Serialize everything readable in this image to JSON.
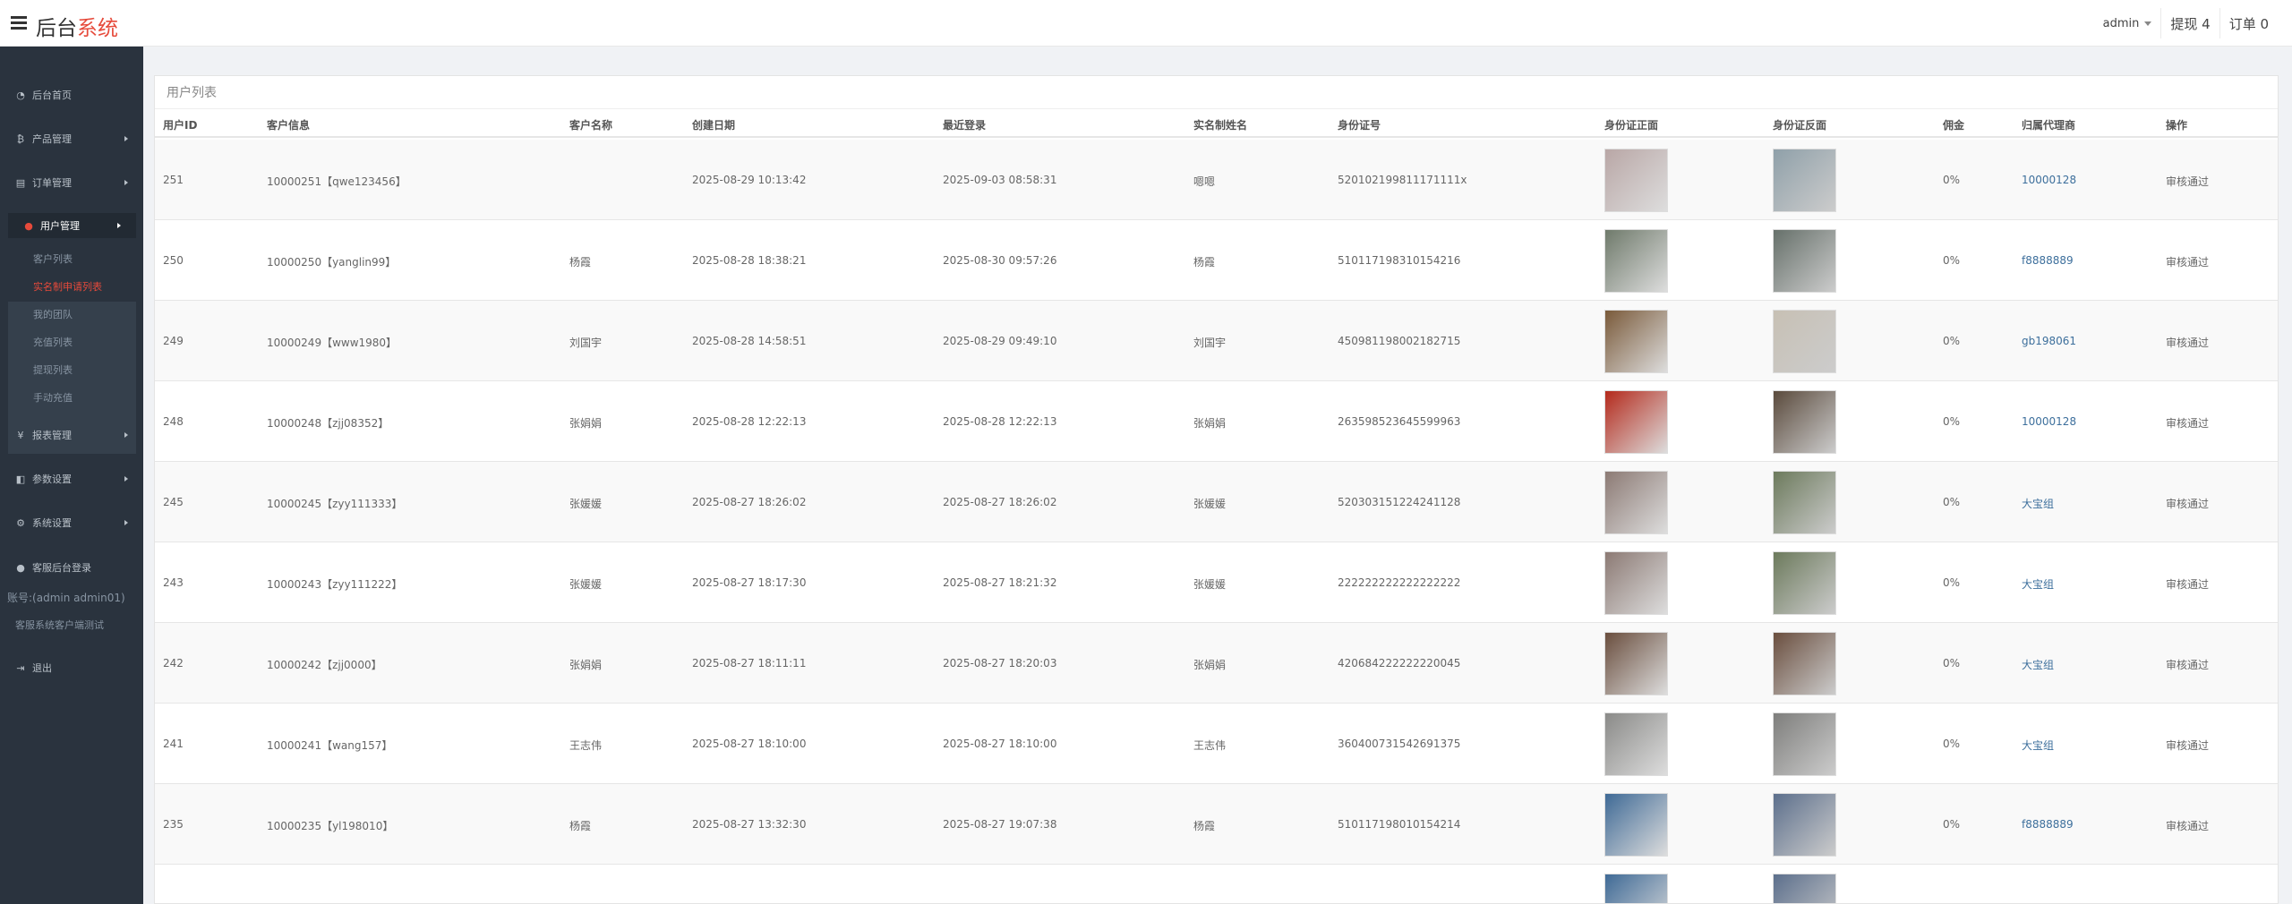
{
  "header": {
    "brand_main": "后台",
    "brand_accent": "系统",
    "admin_label": "admin",
    "withdraw_label": "提现 4",
    "orders_label": "订单 0"
  },
  "sidebar": {
    "items": [
      {
        "label": "后台首页",
        "icon": "dashboard-icon"
      },
      {
        "label": "产品管理",
        "icon": "bitcoin-icon"
      },
      {
        "label": "订单管理",
        "icon": "order-icon"
      },
      {
        "label": "用户管理",
        "icon": "user-icon"
      },
      {
        "label": "报表管理",
        "icon": "yen-icon"
      },
      {
        "label": "参数设置",
        "icon": "params-icon"
      },
      {
        "label": "系统设置",
        "icon": "settings-icon"
      },
      {
        "label": "客服后台登录",
        "icon": "support-user-icon"
      },
      {
        "label": "退出",
        "icon": "logout-icon"
      }
    ],
    "subitems": [
      "客户列表",
      "实名制申请列表",
      "我的团队",
      "充值列表",
      "提现列表",
      "手动充值"
    ],
    "account_text": "账号:(admin admin01)",
    "test_text": "客服系统客户端测试"
  },
  "panel": {
    "title": "用户列表",
    "columns": [
      "用户ID",
      "客户信息",
      "客户名称",
      "创建日期",
      "最近登录",
      "实名制姓名",
      "身份证号",
      "身份证正面",
      "身份证反面",
      "佣金",
      "归属代理商",
      "操作"
    ]
  },
  "rows": [
    {
      "id": "251",
      "info": "10000251【qwe123456】",
      "name": "",
      "created": "2025-08-29 10:13:42",
      "last": "2025-09-03 08:58:31",
      "real": "嗯嗯",
      "idno": "520102199811171111x",
      "comm": "0%",
      "agent": "10000128",
      "action": "审核通过",
      "front": "#b9a7a6",
      "back": "#8fa0a9"
    },
    {
      "id": "250",
      "info": "10000250【yanglin99】",
      "name": "杨霞",
      "created": "2025-08-28 18:38:21",
      "last": "2025-08-30 09:57:26",
      "real": "杨霞",
      "idno": "510117198310154216",
      "comm": "0%",
      "agent": "f8888889",
      "action": "审核通过",
      "front": "#6f7a6b",
      "back": "#66706a"
    },
    {
      "id": "249",
      "info": "10000249【www1980】",
      "name": "刘国宇",
      "created": "2025-08-28 14:58:51",
      "last": "2025-08-29 09:49:10",
      "real": "刘国宇",
      "idno": "450981198002182715",
      "comm": "0%",
      "agent": "gb198061",
      "action": "审核通过",
      "front": "#7a5a3a",
      "back": "#c7c0b4"
    },
    {
      "id": "248",
      "info": "10000248【zjj08352】",
      "name": "张娟娟",
      "created": "2025-08-28 12:22:13",
      "last": "2025-08-28 12:22:13",
      "real": "张娟娟",
      "idno": "263598523645599963",
      "comm": "0%",
      "agent": "10000128",
      "action": "审核通过",
      "front": "#b42a1c",
      "back": "#5a4a3c"
    },
    {
      "id": "245",
      "info": "10000245【zyy111333】",
      "name": "张媛媛",
      "created": "2025-08-27 18:26:02",
      "last": "2025-08-27 18:26:02",
      "real": "张媛媛",
      "idno": "520303151224241128",
      "comm": "0%",
      "agent": "大宝组",
      "action": "审核通过",
      "front": "#8c7a74",
      "back": "#6c7a5c"
    },
    {
      "id": "243",
      "info": "10000243【zyy111222】",
      "name": "张媛媛",
      "created": "2025-08-27 18:17:30",
      "last": "2025-08-27 18:21:32",
      "real": "张媛媛",
      "idno": "222222222222222222",
      "comm": "0%",
      "agent": "大宝组",
      "action": "审核通过",
      "front": "#8c7a74",
      "back": "#6c7a5c"
    },
    {
      "id": "242",
      "info": "10000242【zjj0000】",
      "name": "张娟娟",
      "created": "2025-08-27 18:11:11",
      "last": "2025-08-27 18:20:03",
      "real": "张娟娟",
      "idno": "420684222222220045",
      "comm": "0%",
      "agent": "大宝组",
      "action": "审核通过",
      "front": "#6a4e3e",
      "back": "#6a4e3e"
    },
    {
      "id": "241",
      "info": "10000241【wang157】",
      "name": "王志伟",
      "created": "2025-08-27 18:10:00",
      "last": "2025-08-27 18:10:00",
      "real": "王志伟",
      "idno": "360400731542691375",
      "comm": "0%",
      "agent": "大宝组",
      "action": "审核通过",
      "front": "#8a8a88",
      "back": "#7e7e7c"
    },
    {
      "id": "235",
      "info": "10000235【yl198010】",
      "name": "杨霞",
      "created": "2025-08-27 13:32:30",
      "last": "2025-08-27 19:07:38",
      "real": "杨霞",
      "idno": "510117198010154214",
      "comm": "0%",
      "agent": "f8888889",
      "action": "审核通过",
      "front": "#3f6a96",
      "back": "#5c6f8c"
    },
    {
      "id": "",
      "info": "",
      "name": "",
      "created": "",
      "last": "",
      "real": "",
      "idno": "",
      "comm": "",
      "agent": "",
      "action": "",
      "front": "#3f6a96",
      "back": "#5c6f8c"
    }
  ]
}
